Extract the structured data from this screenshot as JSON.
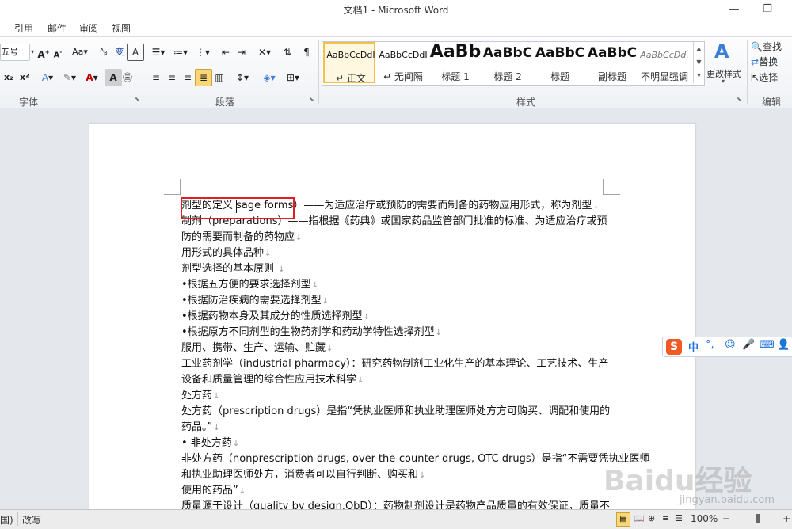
{
  "window": {
    "title": "文档1 - Microsoft Word",
    "min": "—",
    "restore": "❐"
  },
  "menu": [
    "引用",
    "邮件",
    "审阅",
    "视图"
  ],
  "ribbon": {
    "font_size": "五号",
    "groups": {
      "font": "字体",
      "paragraph": "段落",
      "styles": "样式",
      "editing": "编辑"
    },
    "styles": [
      {
        "preview": "AaBbCcDdI",
        "name": "↵ 正文",
        "selected": true
      },
      {
        "preview": "AaBbCcDdI",
        "name": "↵ 无间隔"
      },
      {
        "preview": "AaBb",
        "name": "标题 1"
      },
      {
        "preview": "AaBbC",
        "name": "标题 2"
      },
      {
        "preview": "AaBbC",
        "name": "标题"
      },
      {
        "preview": "AaBbC",
        "name": "副标题"
      },
      {
        "preview": "AaBbCcDd.",
        "name": "不明显强调"
      }
    ],
    "change_styles": "更改样式",
    "find": "查找",
    "replace": "替换",
    "select": "选择"
  },
  "document": {
    "lines": [
      {
        "text": "剂型的定义",
        "extra": " sage forms）——为适应治疗或预防的需要而制备的药物应用形式，称为剂型"
      },
      {
        "text": "制剂（preparations）——指根据《药典》或国家药品监管部门批准的标准、为适应治疗或预"
      },
      {
        "text": "防的需要而制备的药物应"
      },
      {
        "text": "用形式的具体品种"
      },
      {
        "text": "剂型选择的基本原则 "
      },
      {
        "text": "•根据五方便的要求选择剂型"
      },
      {
        "text": "•根据防治疾病的需要选择剂型"
      },
      {
        "text": "•根据药物本身及其成分的性质选择剂型"
      },
      {
        "text": "•根据原方不同剂型的生物药剂学和药动学特性选择剂型"
      },
      {
        "text": " 服用、携带、生产、运输、贮藏"
      },
      {
        "text": "工业药剂学（industrial pharmacy）：研究药物制剂工业化生产的基本理论、工艺技术、生产"
      },
      {
        "text": "设备和质量管理的综合性应用技术科学"
      },
      {
        "text": "处方药"
      },
      {
        "text": " 处方药（prescription drugs）是指“凭执业医师和执业助理医师处方方可购买、调配和使用的"
      },
      {
        "text": "药品。”"
      },
      {
        "text": "• 非处方药"
      },
      {
        "text": "非处方药（nonprescription drugs, over-the-counter drugs, OTC drugs）是指“不需要凭执业医师"
      },
      {
        "text": "和执业助理医师处方，消费者可以自行判断、购买和"
      },
      {
        "text": "使用的药品”"
      },
      {
        "text": "质量源于设计（quality by design,QbD）：药物制剂设计是药物产品质量的有效保证，质量不"
      }
    ]
  },
  "ime": {
    "logo": "S",
    "mode": "中",
    "punct": "°,",
    "emoji": "☺",
    "mic": "🎤",
    "keyboard": "⌨",
    "user": "👤"
  },
  "status": {
    "left": "国)",
    "overtype": "改写",
    "zoom": "100%"
  },
  "watermark": {
    "brand": "Baidu经验",
    "url": "jingyan.baidu.com"
  },
  "colors": {
    "accent_red": "#e02020",
    "ime_blue": "#1d6fd8",
    "style_selected": "#f1c14c"
  }
}
